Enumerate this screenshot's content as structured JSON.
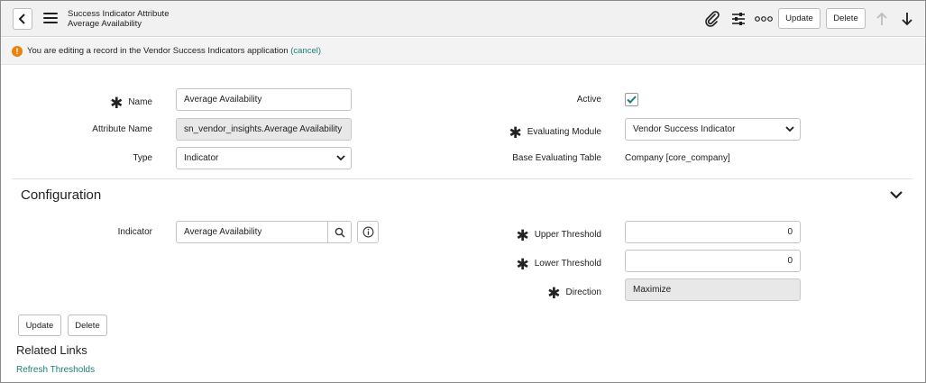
{
  "header": {
    "title": "Success Indicator Attribute",
    "subtitle": "Average Availability",
    "update_label": "Update",
    "delete_label": "Delete"
  },
  "notice": {
    "text": "You are editing a record in the Vendor Success Indicators application",
    "cancel_link": "(cancel)",
    "icon_glyph": "!"
  },
  "form": {
    "name_label": "Name",
    "name_value": "Average Availability",
    "attribute_name_label": "Attribute Name",
    "attribute_name_value": "sn_vendor_insights.Average Availability",
    "type_label": "Type",
    "type_value": "Indicator",
    "active_label": "Active",
    "active_checked": true,
    "evaluating_module_label": "Evaluating Module",
    "evaluating_module_value": "Vendor Success Indicator",
    "base_table_label": "Base Evaluating Table",
    "base_table_value": "Company [core_company]"
  },
  "configuration": {
    "title": "Configuration",
    "indicator_label": "Indicator",
    "indicator_value": "Average Availability",
    "upper_threshold_label": "Upper Threshold",
    "upper_threshold_value": "0",
    "lower_threshold_label": "Lower Threshold",
    "lower_threshold_value": "0",
    "direction_label": "Direction",
    "direction_value": "Maximize"
  },
  "footer": {
    "update_label": "Update",
    "delete_label": "Delete",
    "related_links_title": "Related Links",
    "refresh_link": "Refresh Thresholds"
  },
  "colors": {
    "accent_link": "#1b7f79",
    "warning": "#e8830e",
    "check": "#1b7f79"
  },
  "icons": {
    "back": "chevron-left-icon",
    "menu": "hamburger-icon",
    "attach": "paperclip-icon",
    "settings": "sliders-icon",
    "more": "more-icon",
    "up": "arrow-up-icon",
    "down": "arrow-down-icon",
    "search": "search-icon",
    "info": "info-icon",
    "collapse": "chevron-down-icon"
  }
}
